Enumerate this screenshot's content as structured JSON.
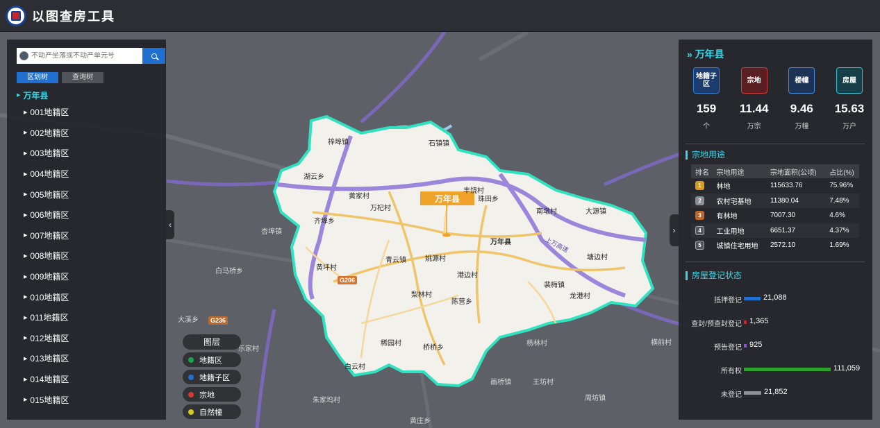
{
  "app": {
    "title": "以图查房工具",
    "logo": "institution-logo"
  },
  "search": {
    "placeholder": "不动产坐落或不动产单元号",
    "icon": "search-icon"
  },
  "tree_tabs": [
    {
      "label": "区划树",
      "active": true
    },
    {
      "label": "查询树",
      "active": false
    }
  ],
  "tree": {
    "root": "万年县",
    "items": [
      "001地籍区",
      "002地籍区",
      "003地籍区",
      "004地籍区",
      "005地籍区",
      "006地籍区",
      "007地籍区",
      "008地籍区",
      "009地籍区",
      "010地籍区",
      "011地籍区",
      "012地籍区",
      "013地籍区",
      "014地籍区",
      "015地籍区"
    ]
  },
  "layers": {
    "title": "图层",
    "items": [
      {
        "label": "地籍区",
        "color": "#1aa64b"
      },
      {
        "label": "地籍子区",
        "color": "#1f6fd1"
      },
      {
        "label": "宗地",
        "color": "#d23a3a"
      },
      {
        "label": "自然幢",
        "color": "#d8c81e"
      }
    ]
  },
  "map": {
    "county_label": "万年县",
    "place_labels": [
      "梓埠镇",
      "石镇镇",
      "湖云乡",
      "黄家村",
      "万杞村",
      "齐埠乡",
      "丰饶村",
      "珠田乡",
      "南墩村",
      "大源镇",
      "万年县",
      "青云镇",
      "姚源村",
      "黄坪村",
      "港边村",
      "裴梅镇",
      "塘边村",
      "龙港村",
      "梨林村",
      "陈营乡",
      "稀园村",
      "桥桥乡",
      "白云村",
      "朱家坞村",
      "画桥镇",
      "王坊村",
      "周坊镇",
      "黄庄乡",
      "大溪乡",
      "杏埠镇",
      "白马桥乡",
      "横前村",
      "乐家村",
      "杨林村"
    ],
    "road_badges": [
      "G206",
      "G236",
      "上万高速"
    ]
  },
  "right": {
    "title": "万年县",
    "stats": [
      {
        "icon_text": "地籍子区",
        "value": "159",
        "unit": "个",
        "color": "#2a7fd8"
      },
      {
        "icon_text": "宗地",
        "value": "11.44",
        "unit": "万宗",
        "color": "#d23a3a"
      },
      {
        "icon_text": "楼幢",
        "value": "9.46",
        "unit": "万幢",
        "color": "#3a8fe0"
      },
      {
        "icon_text": "房屋",
        "value": "15.63",
        "unit": "万户",
        "color": "#2ac5d6"
      }
    ],
    "usage_title": "宗地用途",
    "usage_headers": [
      "排名",
      "宗地用途",
      "宗地面积(公顷)",
      "占比(%)"
    ],
    "usage_rows": [
      {
        "rank": "1",
        "name": "林地",
        "area": "115633.76",
        "pct": "75.96%",
        "color": "#d99b24"
      },
      {
        "rank": "2",
        "name": "农村宅基地",
        "area": "11380.04",
        "pct": "7.48%",
        "color": "#8a8d93"
      },
      {
        "rank": "3",
        "name": "有林地",
        "area": "7007.30",
        "pct": "4.6%",
        "color": "#c2662a"
      },
      {
        "rank": "4",
        "name": "工业用地",
        "area": "6651.37",
        "pct": "4.37%",
        "color": "#50545a"
      },
      {
        "rank": "5",
        "name": "城镇住宅用地",
        "area": "2572.10",
        "pct": "1.69%",
        "color": "#50545a"
      }
    ],
    "reg_title": "房屋登记状态",
    "chart_data": {
      "type": "bar",
      "orientation": "horizontal",
      "categories": [
        "抵押登记",
        "查封/预查封登记",
        "预告登记",
        "所有权",
        "未登记"
      ],
      "values": [
        21088,
        1365,
        925,
        111059,
        21852
      ],
      "value_labels": [
        "21,088",
        "1,365",
        "925",
        "111,059",
        "21,852"
      ],
      "colors": [
        "#1f6fd1",
        "#c42b2b",
        "#8a55c9",
        "#2ea02e",
        "#8d9096"
      ]
    }
  }
}
